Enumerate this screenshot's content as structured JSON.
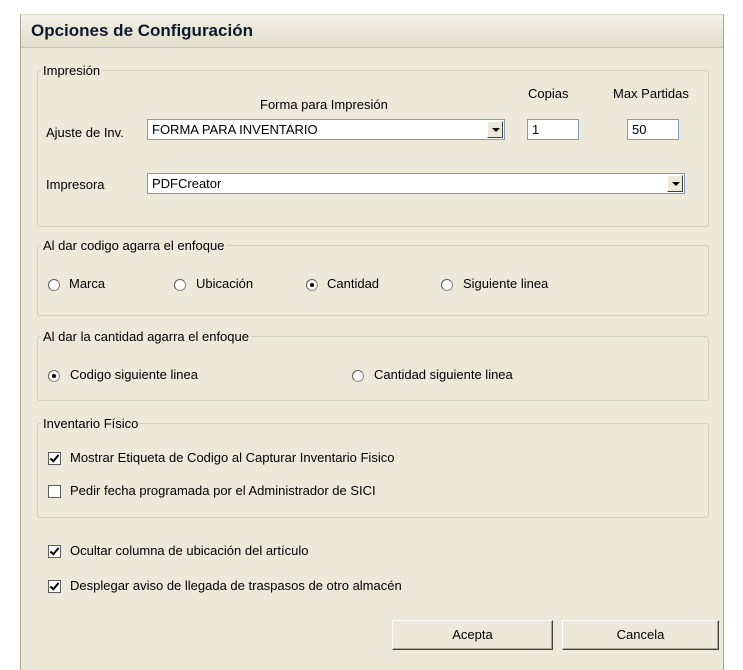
{
  "window": {
    "title": "Opciones de Configuración"
  },
  "impresion": {
    "legend": "Impresión",
    "forma_label": "Forma para Impresión",
    "copias_label": "Copias",
    "max_partidas_label": "Max Partidas",
    "ajuste_label": "Ajuste de Inv.",
    "forma_value": "FORMA PARA INVENTARIO",
    "copias_value": "1",
    "max_partidas_value": "50",
    "impresora_label": "Impresora",
    "impresora_value": "PDFCreator"
  },
  "enfoque_codigo": {
    "legend": "Al dar codigo agarra el enfoque",
    "options": [
      {
        "label": "Marca",
        "selected": false
      },
      {
        "label": "Ubicación",
        "selected": false
      },
      {
        "label": "Cantidad",
        "selected": true
      },
      {
        "label": "Siguiente linea",
        "selected": false
      }
    ]
  },
  "enfoque_cantidad": {
    "legend": "Al dar la cantidad agarra el enfoque",
    "options": [
      {
        "label": "Codigo siguiente linea",
        "selected": true
      },
      {
        "label": "Cantidad siguiente linea",
        "selected": false
      }
    ]
  },
  "inventario_fisico": {
    "legend": "Inventario Físico",
    "options": [
      {
        "label": "Mostrar Etiqueta de Codigo al Capturar Inventario Fisico",
        "checked": true
      },
      {
        "label": "Pedir fecha programada por el Administrador de SICI",
        "checked": false
      }
    ]
  },
  "extra_options": [
    {
      "label": "Ocultar columna de ubicación del artículo",
      "checked": true
    },
    {
      "label": "Desplegar aviso de llegada de traspasos de otro almacén",
      "checked": true
    }
  ],
  "buttons": {
    "accept": "Acepta",
    "cancel": "Cancela"
  }
}
